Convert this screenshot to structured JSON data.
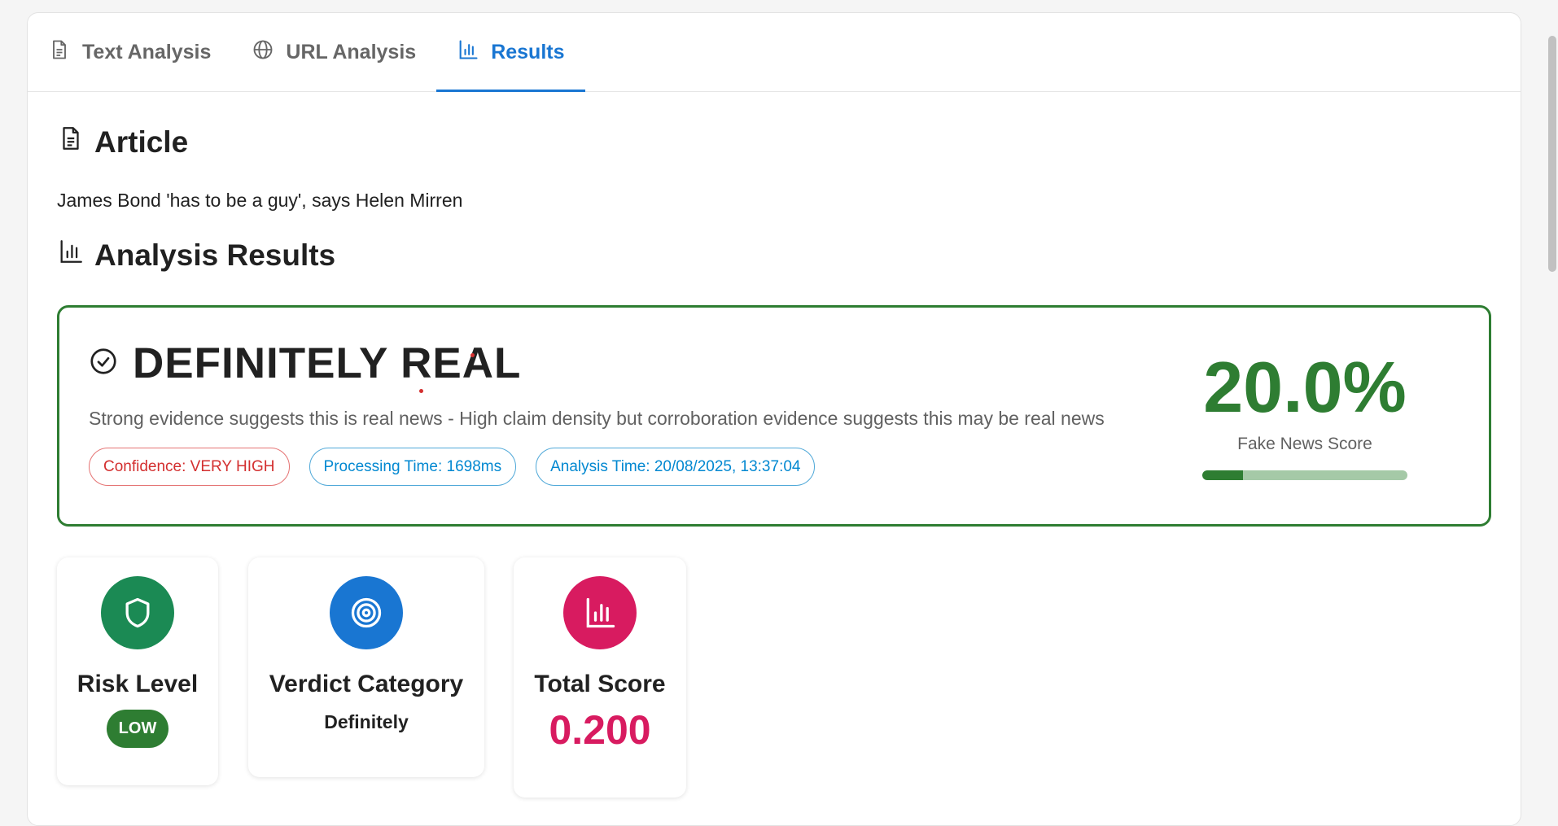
{
  "tabs": [
    {
      "label": "Text Analysis",
      "icon": "document-icon"
    },
    {
      "label": "URL Analysis",
      "icon": "globe-icon"
    },
    {
      "label": "Results",
      "icon": "bar-chart-icon"
    }
  ],
  "active_tab": "Results",
  "article": {
    "heading": "Article",
    "text": "James Bond 'has to be a guy', says Helen Mirren"
  },
  "analysis": {
    "heading": "Analysis Results",
    "verdict": "DEFINITELY REAL",
    "description": "Strong evidence suggests this is real news - High claim density but corroboration evidence suggests this may be real news",
    "chips": {
      "confidence": "Confidence: VERY HIGH",
      "processing_time": "Processing Time: 1698ms",
      "analysis_time": "Analysis Time: 20/08/2025, 13:37:04"
    },
    "score_value": "20.0%",
    "score_label": "Fake News Score",
    "score_fraction": 0.2
  },
  "stats": {
    "risk": {
      "label": "Risk Level",
      "value": "LOW",
      "color": "#1b8a54"
    },
    "verdict_category": {
      "label": "Verdict Category",
      "value": "Definitely",
      "color": "#1976d2"
    },
    "total_score": {
      "label": "Total Score",
      "value": "0.200",
      "color": "#d81b60"
    }
  },
  "colors": {
    "accent": "#1976d2",
    "real_green": "#2e7d32",
    "confidence_red": "#d32f2f"
  }
}
